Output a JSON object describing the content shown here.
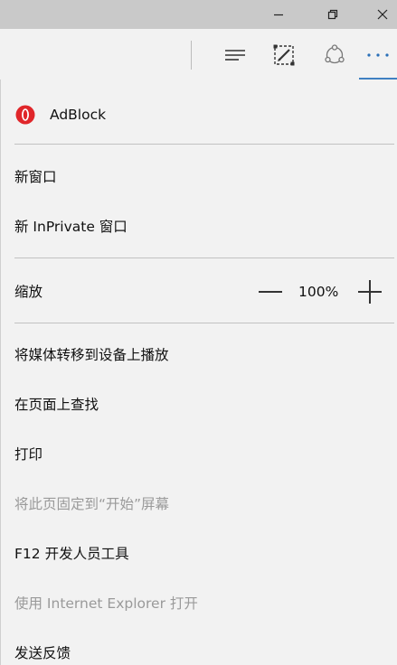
{
  "window": {
    "minimize_icon": "minimize-icon",
    "restore_icon": "restore-icon",
    "close_icon": "close-icon"
  },
  "toolbar": {
    "icons": [
      "hub-icon",
      "web-note-icon",
      "share-icon",
      "more-icon"
    ],
    "accent_color": "#3f80c2"
  },
  "menu": {
    "extension": {
      "label": "AdBlock",
      "icon": "adblock-icon",
      "icon_color": "#e0262a"
    },
    "new_window": "新窗口",
    "new_inprivate": "新 InPrivate 窗口",
    "zoom": {
      "label": "缩放",
      "value": "100%"
    },
    "cast": "将媒体转移到设备上播放",
    "find": "在页面上查找",
    "print": "打印",
    "pin_start": "将此页固定到“开始”屏幕",
    "devtools": "F12 开发人员工具",
    "open_ie": "使用 Internet Explorer 打开",
    "feedback": "发送反馈"
  }
}
